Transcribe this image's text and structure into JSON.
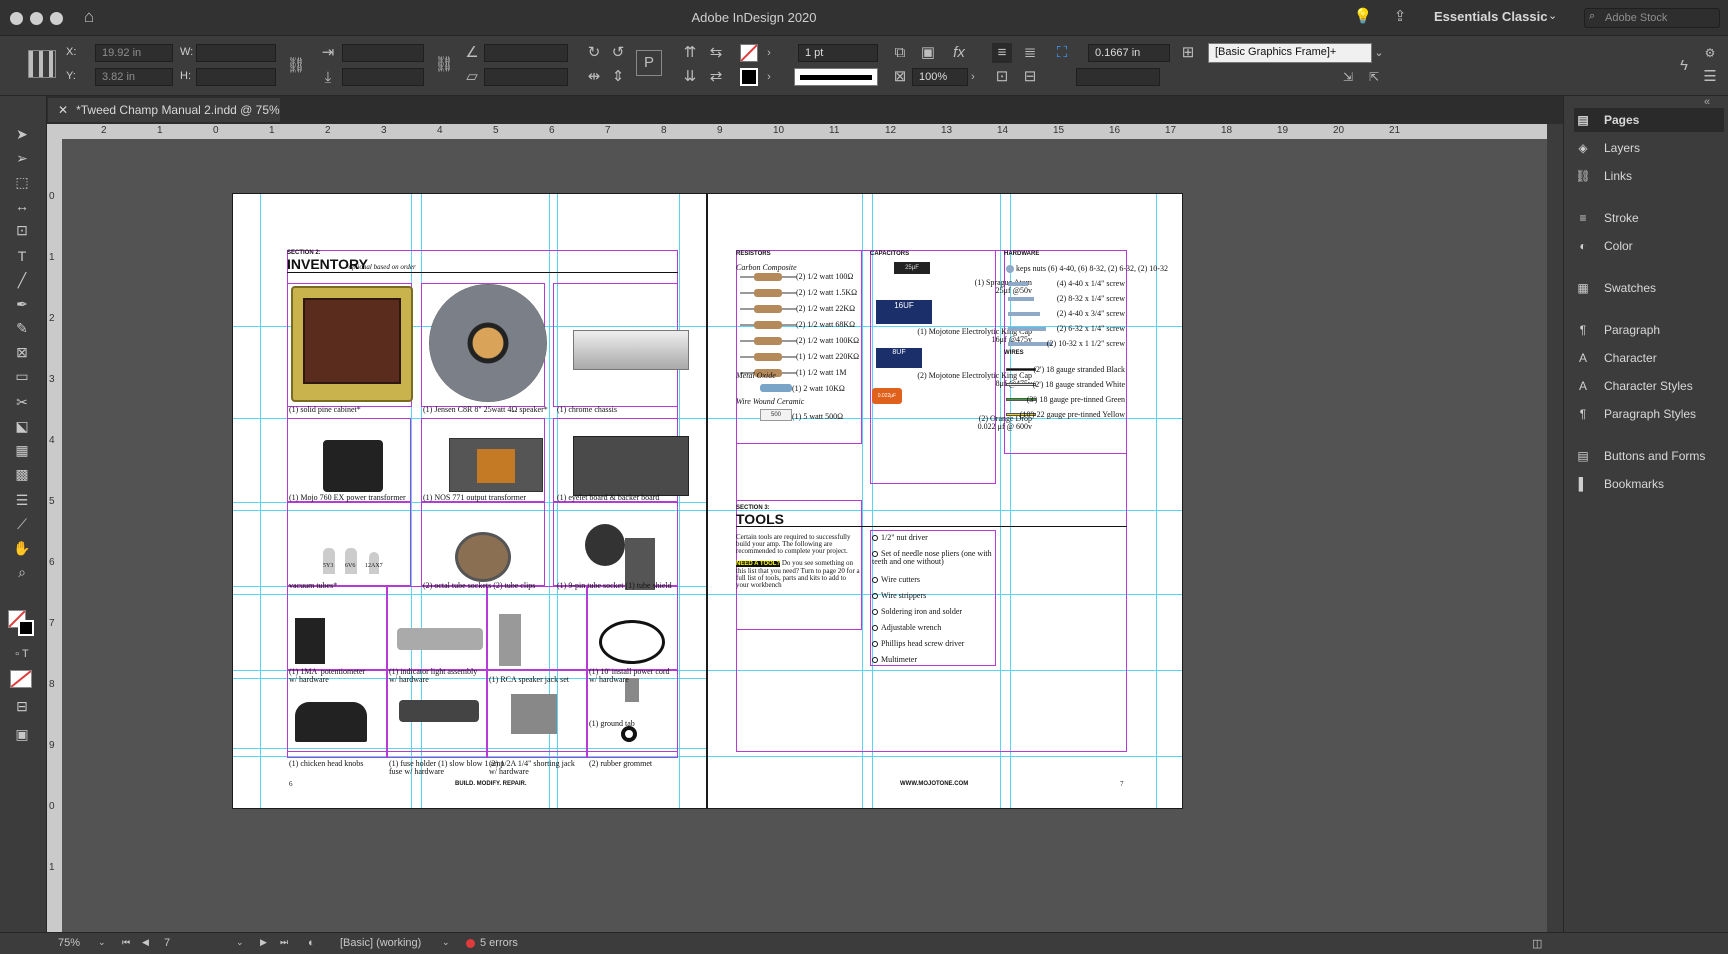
{
  "app": {
    "title": "Adobe InDesign 2020",
    "workspace": "Essentials Classic",
    "search_placeholder": "Adobe Stock"
  },
  "control": {
    "x_label": "X:",
    "x_value": "19.92 in",
    "y_label": "Y:",
    "y_value": "3.82 in",
    "w_label": "W:",
    "h_label": "H:",
    "stroke_weight": "1 pt",
    "scale": "100%",
    "offset": "0.1667 in",
    "object_style": "[Basic Graphics Frame]+"
  },
  "document": {
    "tab_title": "*Tweed Champ Manual 2.indd @ 75%"
  },
  "ruler": {
    "h": [
      "2",
      "1",
      "0",
      "1",
      "2",
      "3",
      "4",
      "5",
      "6",
      "7",
      "8",
      "9",
      "10",
      "11",
      "12",
      "13",
      "14",
      "15",
      "16",
      "17",
      "18",
      "19",
      "20",
      "21"
    ],
    "v": [
      "0",
      "1",
      "2",
      "3",
      "4",
      "5",
      "6",
      "7",
      "8",
      "9",
      "0",
      "1"
    ]
  },
  "left_page": {
    "section_label": "SECTION 2:",
    "heading": "INVENTORY",
    "note": "*optional based on order",
    "captions": [
      "(1) solid pine cabinet*",
      "(1) Jensen C8R 8\" 25watt 4Ω speaker*",
      "(1) chrome chassis",
      "(1) Mojo 760 EX power transformer",
      "(1) NOS 771 output transformer",
      "(1) eyelet board & backer board",
      "vacuum tubes*",
      "(2) octal tube sockets (2) tube clips",
      "(1) 9-pin tube socket (1) tube shield",
      "(1) 1MA  potentiometer\nw/ hardware",
      "(1) indicator light assembly\nw/ hardware",
      "(1) RCA speaker jack set",
      "(1) 10' install power cord\nw/ hardware",
      "(1) chicken head knobs",
      "(1) fuse holder (1) slow blow 1 amp\nfuse w/ hardware",
      "(2) 1/2A 1/4\" shorting jack\nw/ hardware",
      "(1) ground tab",
      "(2) rubber grommet"
    ],
    "tube_labels": [
      "5Y3",
      "6V6",
      "12AX7"
    ],
    "folio": "6",
    "footer": "BUILD. MODIFY. REPAIR."
  },
  "right_page": {
    "resistors_title": "RESISTORS",
    "carbon_title": "Carbon Composite",
    "resistors": [
      "(2) 1/2 watt 100Ω",
      "(2) 1/2 watt 1.5KΩ",
      "(2) 1/2 watt 22KΩ",
      "(2) 1/2 watt 68KΩ",
      "(2) 1/2 watt 100KΩ",
      "(1) 1/2 watt 220KΩ",
      "(1) 1/2 watt 1M"
    ],
    "metal_title": "Metal Oxide",
    "metal_item": "(1) 2 watt 10KΩ",
    "wire_title": "Wire Wound Ceramic",
    "wire_item": "(1) 5 watt 500Ω",
    "wire_band": "500",
    "capacitors_title": "CAPACITORS",
    "capacitors": [
      "(1) Sprague Atom\n25μf @50v",
      "(1) Mojotone Electrolytic King Cap\n16μf @475v",
      "(2) Mojotone Electrolytic King Cap\n8μf @475v",
      "(2) Orange Drop\n0.022 μf @ 600v"
    ],
    "cap_marks": [
      "25μF",
      "16UF",
      "8UF",
      "0.022μF"
    ],
    "hardware_title": "HARDWARE",
    "hardware": [
      "keps nuts (6) 4-40, (6) 8-32, (2) 6-32, (2) 10-32",
      "(4) 4-40 x 1/4\" screw",
      "(2) 8-32 x 1/4\" screw",
      "(2) 4-40 x 3/4\" screw",
      "(2) 6-32 x 1/4\" screw",
      "(2) 10-32 x 1 1/2\" screw"
    ],
    "wires_title": "WIRES",
    "wires": [
      "(2') 18 gauge stranded Black",
      "(2') 18 gauge stranded White",
      "(3') 18 gauge pre-tinned Green",
      "(10') 22 gauge pre-tinned Yellow"
    ],
    "tools_section": "SECTION 3:",
    "tools_heading": "TOOLS",
    "tools_intro": "Certain tools are required to successfully build your amp. The following are recommended to complete your project.",
    "tools_need": "NEED A TOOL?",
    "tools_need_text": "Do you see something on this list that you need? Turn to page 20 for a full list of tools, parts and kits to add to your workbench",
    "tools": [
      "1/2\" nut driver",
      "Set of needle nose pliers (one with teeth and one without)",
      "Wire cutters",
      "Wire strippers",
      "Soldering iron and solder",
      "Adjustable wrench",
      "Phillips head screw driver",
      "Multimeter"
    ],
    "footer": "WWW.MOJOTONE.COM",
    "folio": "7"
  },
  "panel": {
    "items": [
      "Pages",
      "Layers",
      "Links",
      "Stroke",
      "Color",
      "Swatches",
      "Paragraph",
      "Character",
      "Character Styles",
      "Paragraph Styles",
      "Buttons and Forms",
      "Bookmarks"
    ]
  },
  "status": {
    "zoom": "75%",
    "page": "7",
    "style": "[Basic] (working)",
    "errors": "5 errors"
  },
  "colors": {
    "guide": "#56d6f0",
    "margin": "#b53ad6",
    "error": "#e03b3b",
    "cabinet": "#c9b34c"
  }
}
